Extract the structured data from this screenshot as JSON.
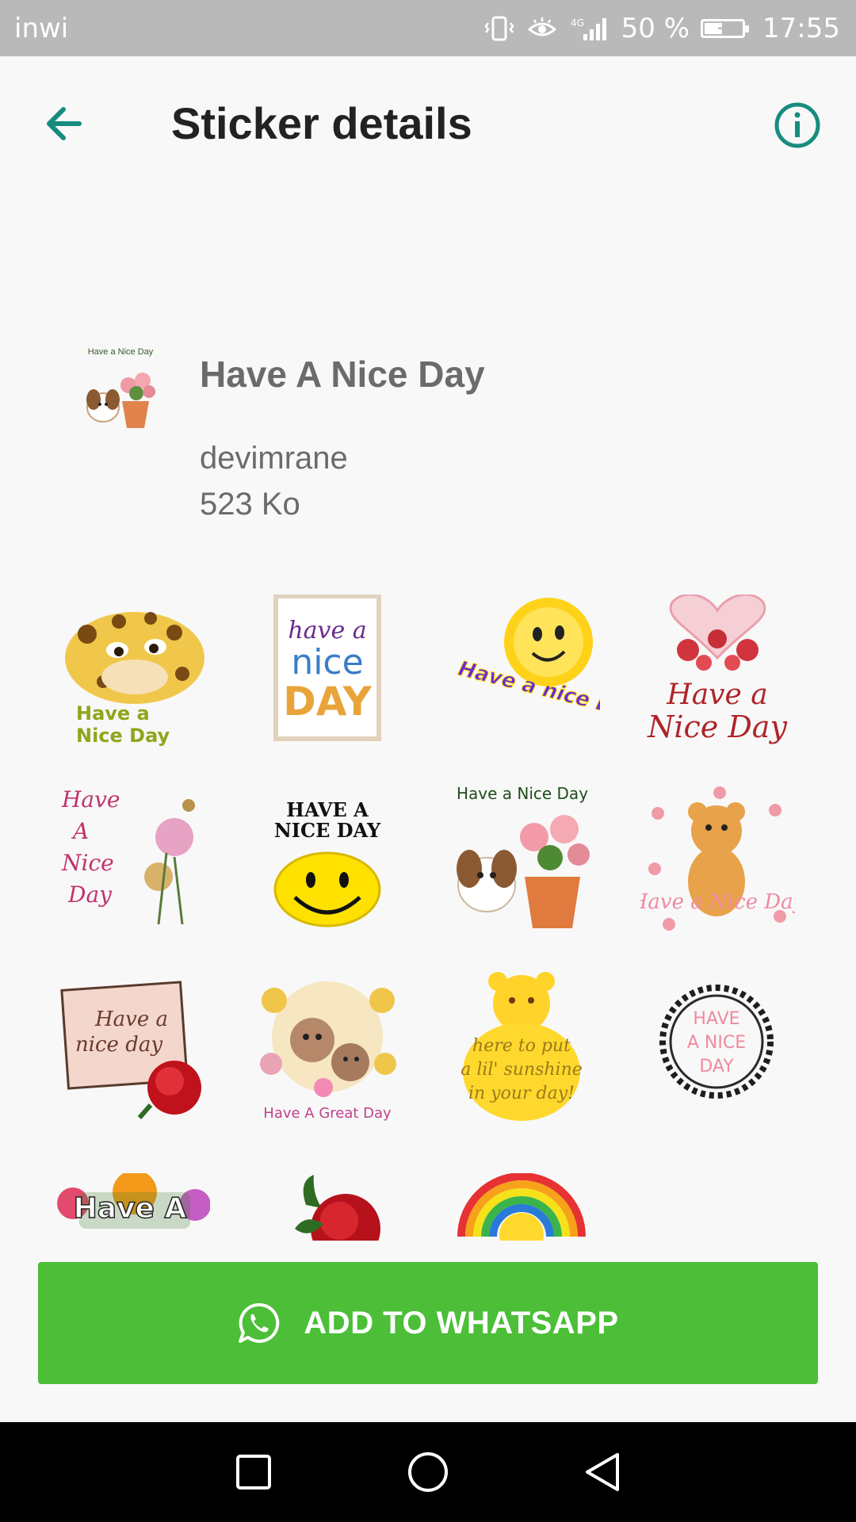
{
  "status_bar": {
    "carrier": "inwi",
    "network": "4G",
    "battery": "50 %",
    "time": "17:55"
  },
  "app_bar": {
    "title": "Sticker details",
    "back_icon": "arrow-back-icon",
    "info_icon": "info-icon"
  },
  "pack": {
    "icon_caption": "Have a Nice Day",
    "name": "Have A Nice Day",
    "author": "devimrane",
    "size": "523 Ko"
  },
  "stickers": [
    {
      "label_1": "Have a",
      "label_2": "Nice Day"
    },
    {
      "label_1": "have a",
      "label_2": "nice",
      "label_3": "DAY"
    },
    {
      "label": "Have a nice Day!"
    },
    {
      "label_1": "Have a",
      "label_2": "Nice Day"
    },
    {
      "label_1": "Have",
      "label_2": "A",
      "label_3": "Nice",
      "label_4": "Day"
    },
    {
      "label_1": "HAVE A",
      "label_2": "NICE DAY"
    },
    {
      "label": "Have a Nice Day"
    },
    {
      "label": "Have a Nice Day"
    },
    {
      "label_1": "Have a",
      "label_2": "nice day"
    },
    {
      "label": "Have A Great Day"
    },
    {
      "label_1": "here to put",
      "label_2": "a lil' sunshine",
      "label_3": "in your day!"
    },
    {
      "label_1": "HAVE",
      "label_2": "A NICE",
      "label_3": "DAY"
    },
    {
      "label": "Have A"
    },
    {
      "label": ""
    },
    {
      "label": ""
    }
  ],
  "cta": {
    "label": "ADD TO WHATSAPP",
    "icon": "whatsapp-icon"
  },
  "colors": {
    "accent": "#168c7e",
    "cta": "#4cbe38",
    "statusbar": "#b9b9b9"
  }
}
